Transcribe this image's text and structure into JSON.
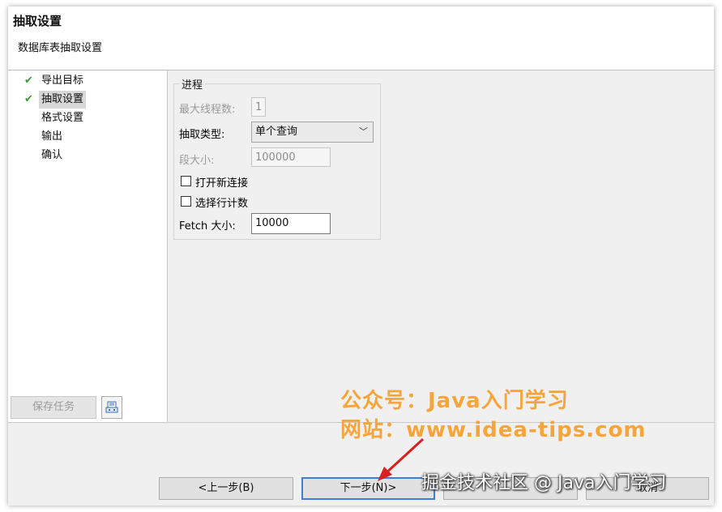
{
  "header": {
    "title": "抽取设置",
    "subtitle": "数据库表抽取设置"
  },
  "nav": {
    "items": [
      {
        "label": "导出目标",
        "checked": true,
        "selected": false
      },
      {
        "label": "抽取设置",
        "checked": true,
        "selected": true
      },
      {
        "label": "格式设置",
        "checked": false,
        "selected": false
      },
      {
        "label": "输出",
        "checked": false,
        "selected": false
      },
      {
        "label": "确认",
        "checked": false,
        "selected": false
      }
    ],
    "save_task_label": "保存任务",
    "icon": "save-settings-icon"
  },
  "form": {
    "group_title": "进程",
    "max_threads_label": "最大线程数:",
    "max_threads_value": "1",
    "extract_type_label": "抽取类型:",
    "extract_type_value": "单个查询",
    "segment_size_label": "段大小:",
    "segment_size_value": "100000",
    "open_new_connection_label": "打开新连接",
    "open_new_connection_checked": false,
    "select_row_count_label": "选择行计数",
    "select_row_count_checked": false,
    "fetch_size_label": "Fetch 大小:",
    "fetch_size_value": "10000"
  },
  "footer": {
    "back_label": "<上一步(B)",
    "next_label": "下一步(N)>",
    "cancel_label": "取消"
  },
  "watermark": {
    "line1": "公众号：Java入门学习",
    "line2": "网站：www.idea-tips.com",
    "line3": "掘金技术社区 @ Java入门学习"
  },
  "colors": {
    "accent": "#3c7fd6",
    "check": "#3a9a3a",
    "watermark": "#f6a53b"
  }
}
